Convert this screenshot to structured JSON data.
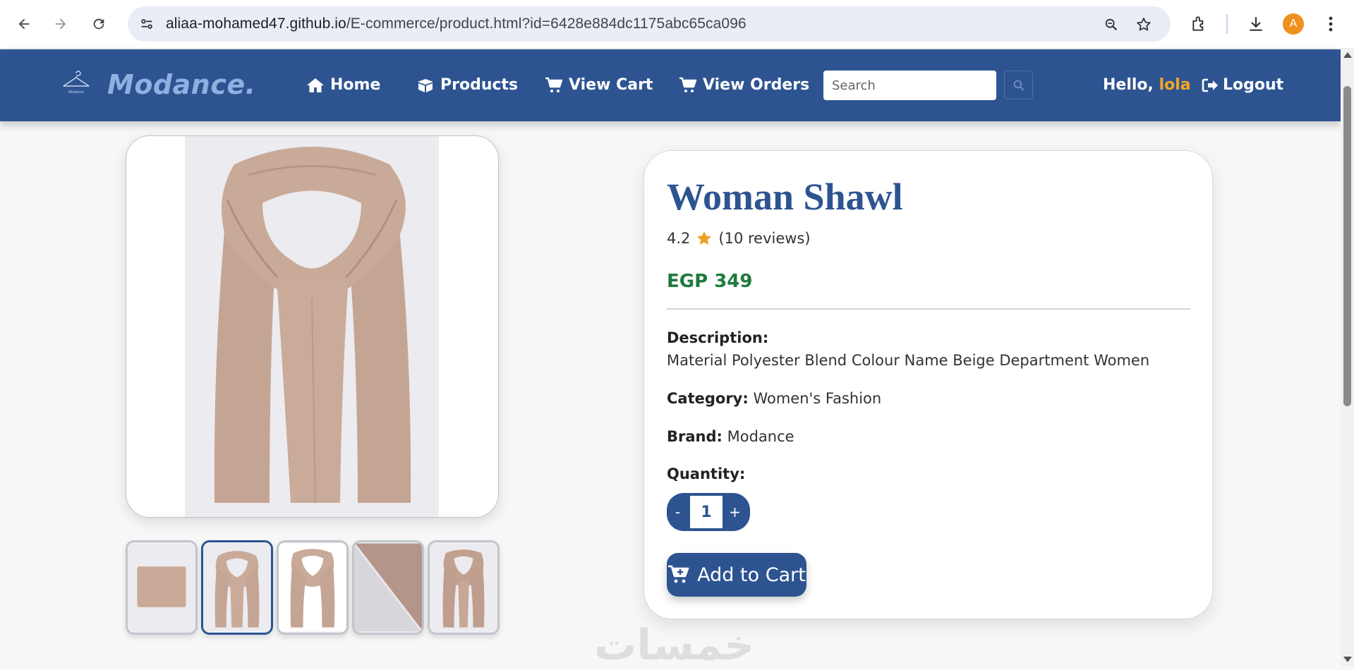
{
  "browser": {
    "url_host": "aliaa-mohamed47.github.io",
    "url_path": "/E-commerce/product.html?id=6428e884dc1175abc65ca096",
    "profile_initial": "A"
  },
  "header": {
    "brand": "Modance.",
    "logo_text": "Modance",
    "nav": {
      "home": "Home",
      "products": "Products",
      "cart": "View Cart",
      "orders": "View Orders"
    },
    "search_placeholder": "Search",
    "greeting_prefix": "Hello,",
    "username": "lola",
    "logout": "Logout"
  },
  "product": {
    "title": "Woman Shawl",
    "rating": "4.2",
    "reviews": "(10 reviews)",
    "price": "EGP 349",
    "description_label": "Description:",
    "description": "Material Polyester Blend Colour Name Beige Department Women",
    "category_label": "Category:",
    "category": "Women's Fashion",
    "brand_label": "Brand:",
    "brand": "Modance",
    "quantity_label": "Quantity:",
    "quantity": "1",
    "minus": "-",
    "plus": "+",
    "add_to_cart": "Add to Cart"
  },
  "watermark": "خمسات",
  "colors": {
    "primary": "#2d5491",
    "accent": "#f5a623",
    "price": "#1f7a3e",
    "shawl": "#c9aa98"
  }
}
